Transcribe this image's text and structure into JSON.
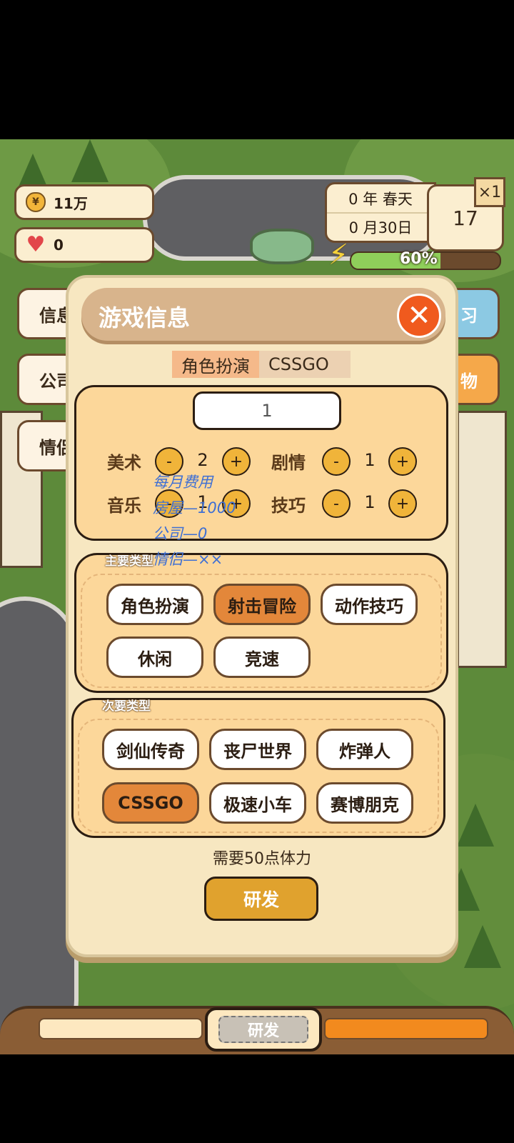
{
  "hud": {
    "money": "11万",
    "hearts": "0",
    "year_season": "0 年 春天",
    "month_day": "0 月30日",
    "day_number": "17",
    "speed": "×1",
    "energy_percent": 60,
    "energy_text": "60%"
  },
  "side_buttons": {
    "left_1": "信息",
    "left_2": "公司",
    "left_3": "情侣",
    "right_1": "习",
    "right_2": "物"
  },
  "modal": {
    "title": "游戏信息",
    "main_genre": "角色扮演",
    "sub_genre": "CSSGO",
    "level": "1",
    "stats": [
      {
        "label": "美术",
        "value": "2"
      },
      {
        "label": "剧情",
        "value": "1"
      },
      {
        "label": "音乐",
        "value": "1"
      },
      {
        "label": "技巧",
        "value": "1"
      }
    ],
    "overlay_lines": [
      "每月费用",
      "房屋—1000",
      "公司—0",
      "情侣—××"
    ],
    "main_type_label": "主要类型",
    "main_types": [
      "角色扮演",
      "射击冒险",
      "动作技巧",
      "休闲",
      "竞速"
    ],
    "main_selected": "射击冒险",
    "secondary_type_label": "次要类型",
    "secondary_types": [
      "剑仙传奇",
      "丧尸世界",
      "炸弹人",
      "CSSGO",
      "极速小车",
      "赛博朋克"
    ],
    "secondary_selected": "CSSGO",
    "energy_required": "需要50点体力",
    "develop_button": "研发"
  },
  "bottom": {
    "tab_label": "研发"
  },
  "colors": {
    "accent_orange": "#f05a1e",
    "selected_chip": "#e3873a",
    "panel": "#fcd79a",
    "energy_fill": "#8fcf5a"
  }
}
